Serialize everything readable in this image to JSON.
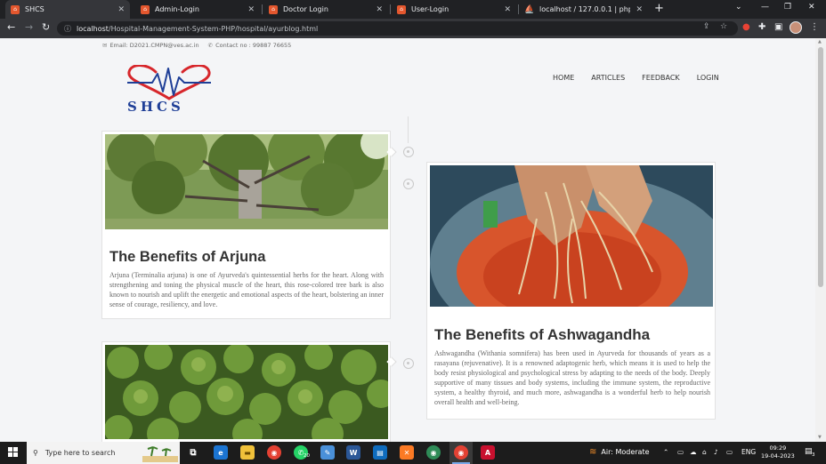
{
  "browser": {
    "tabs": [
      {
        "label": "SHCS",
        "active": true
      },
      {
        "label": "Admin-Login",
        "active": false
      },
      {
        "label": "Doctor Login",
        "active": false
      },
      {
        "label": "User-Login",
        "active": false
      },
      {
        "label": "localhost / 127.0.0.1 | phpMyAdm",
        "active": false
      }
    ],
    "url_host": "localhost",
    "url_path": "/Hospital-Management-System-PHP/hospital/ayurblog.html"
  },
  "topinfo": {
    "email": "Email: D2021.CMPN@ves.ac.in",
    "contact": "Contact no : 99887 76655"
  },
  "logo": {
    "text": "SHCS",
    "heart_color": "#d7262b",
    "text_color": "#1f3f97"
  },
  "nav": {
    "items": [
      "HOME",
      "ARTICLES",
      "FEEDBACK",
      "LOGIN"
    ]
  },
  "articles": [
    {
      "title": "The Benefits of Arjuna",
      "body": "Arjuna (Terminalia arjuna) is one of Ayurveda's quintessential herbs for the heart. Along with strengthening and toning the physical muscle of the heart, this rose-colored tree bark is also known to nourish and uplift the energetic and emotional aspects of the heart, bolstering an inner sense of courage, resiliency, and love.",
      "image": "arjuna-tree-photo"
    },
    {
      "title": "The Benefits of Ashwagandha",
      "body": "Ashwagandha (Withania somnifera) has been used in Ayurveda for thousands of years as a rasayana (rejuvenative). It is a renowned adaptogenic herb, which means it is used to help the body resist physiological and psychological stress by adapting to the needs of the body. Deeply supportive of many tissues and body systems, including the immune system, the reproductive system, a healthy thyroid, and much more, ashwagandha is a wonderful herb to help nourish overall health and well-being.",
      "image": "ashwagandha-roots-photo"
    },
    {
      "title": "",
      "body": "",
      "image": "leafy-herb-plants-photo"
    }
  ],
  "taskbar": {
    "search_placeholder": "Type here to search",
    "weather": "Air: Moderate",
    "lang": "ENG",
    "time": "09:29",
    "date": "19-04-2023",
    "whatsapp_badge": "20",
    "notification_count": "3"
  }
}
